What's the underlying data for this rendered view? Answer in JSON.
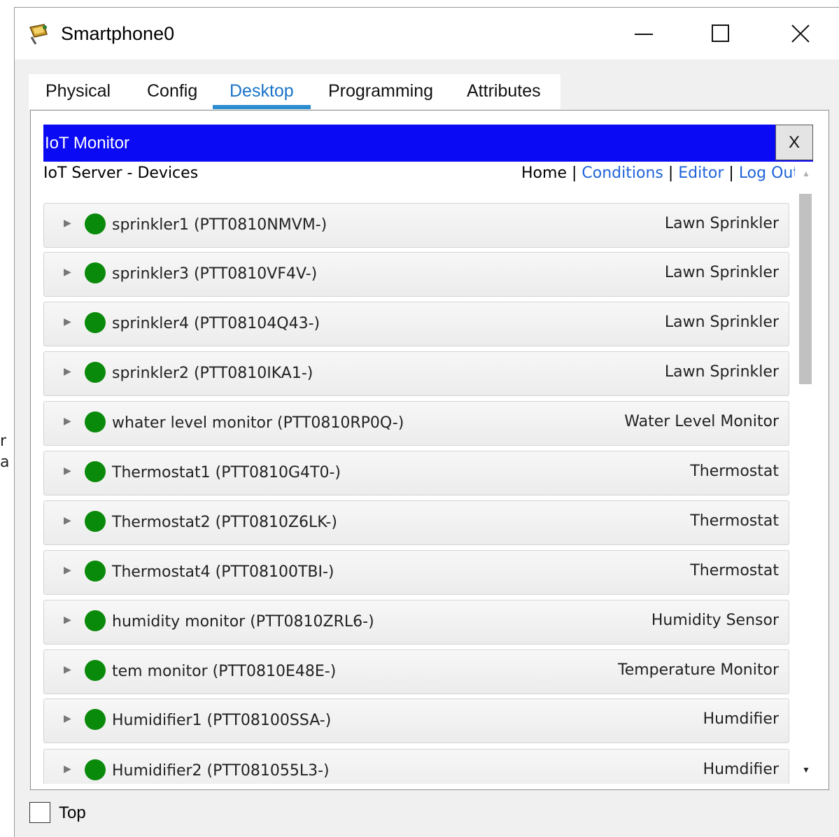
{
  "window": {
    "title": "Smartphone0",
    "icon": "smartphone-app-icon",
    "controls": [
      "minimize-icon",
      "maximize-icon",
      "close-icon"
    ]
  },
  "tabs": [
    {
      "label": "Physical",
      "active": false
    },
    {
      "label": "Config",
      "active": false
    },
    {
      "label": "Desktop",
      "active": true
    },
    {
      "label": "Programming",
      "active": false
    },
    {
      "label": "Attributes",
      "active": false
    }
  ],
  "iot": {
    "title": "IoT Monitor",
    "close_label": "X",
    "server_title": "IoT Server - Devices",
    "nav": {
      "home": "Home",
      "sep": "|",
      "conditions": "Conditions",
      "editor": "Editor",
      "logout": "Log Out"
    }
  },
  "devices": [
    {
      "name": "sprinkler1 (PTT0810NMVM-)",
      "type": "Lawn Sprinkler"
    },
    {
      "name": "sprinkler3 (PTT0810VF4V-)",
      "type": "Lawn Sprinkler"
    },
    {
      "name": "sprinkler4 (PTT08104Q43-)",
      "type": "Lawn Sprinkler"
    },
    {
      "name": "sprinkler2 (PTT0810IKA1-)",
      "type": "Lawn Sprinkler"
    },
    {
      "name": "whater level monitor (PTT0810RP0Q-)",
      "type": "Water Level Monitor"
    },
    {
      "name": "Thermostat1 (PTT0810G4T0-)",
      "type": "Thermostat"
    },
    {
      "name": "Thermostat2 (PTT0810Z6LK-)",
      "type": "Thermostat"
    },
    {
      "name": "Thermostat4 (PTT08100TBI-)",
      "type": "Thermostat"
    },
    {
      "name": "humidity monitor (PTT0810ZRL6-)",
      "type": "Humidity Sensor"
    },
    {
      "name": "tem monitor (PTT0810E48E-)",
      "type": "Temperature Monitor"
    },
    {
      "name": "Humidifier1 (PTT08100SSA-)",
      "type": "Humdifier"
    },
    {
      "name": "Humidifier2 (PTT081055L3-)",
      "type": "Humdifier"
    }
  ],
  "colors": {
    "status_online": "#0a8a0a",
    "iot_bar": "#0a0af5",
    "link": "#1e63d8",
    "active_tab": "#1a73c8"
  },
  "bottom": {
    "top_checkbox_label": "Top",
    "top_checked": false
  }
}
